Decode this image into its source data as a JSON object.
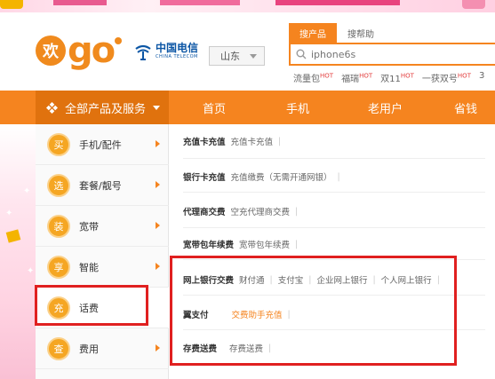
{
  "header": {
    "logo_huan": "欢",
    "logo_go": "go",
    "telecom_cn": "中国电信",
    "telecom_en": "CHINA TELECOM",
    "region": "山东"
  },
  "search": {
    "tabs": [
      "搜产品",
      "搜帮助"
    ],
    "placeholder": "iphone6s",
    "hot_links": [
      {
        "label": "流量包",
        "badge": "HOT"
      },
      {
        "label": "福瑞",
        "badge": "HOT"
      },
      {
        "label": "双11",
        "badge": "HOT"
      },
      {
        "label": "一获双号",
        "badge": "HOT"
      },
      {
        "label": "3",
        "badge": ""
      }
    ]
  },
  "nav": {
    "all_products": "全部产品及服务",
    "items": [
      "首页",
      "手机",
      "老用户",
      "省钱"
    ]
  },
  "categories": [
    {
      "icon": "买",
      "label": "手机/配件"
    },
    {
      "icon": "选",
      "label": "套餐/靓号"
    },
    {
      "icon": "装",
      "label": "宽带"
    },
    {
      "icon": "享",
      "label": "智能"
    },
    {
      "icon": "充",
      "label": "话费"
    },
    {
      "icon": "查",
      "label": "费用"
    }
  ],
  "panel": {
    "rows": [
      {
        "title": "充值卡充值",
        "links": [
          "充值卡充值"
        ]
      },
      {
        "title": "银行卡充值",
        "links": [
          "充值缴费（无需开通网银）"
        ]
      },
      {
        "title": "代理商交费",
        "links": [
          "空充代理商交费"
        ]
      },
      {
        "title": "宽带包年续费",
        "links": [
          "宽带包年续费"
        ]
      },
      {
        "title": "网上银行交费",
        "links": [
          "财付通",
          "支付宝",
          "企业网上银行",
          "个人网上银行"
        ]
      },
      {
        "title": "翼支付",
        "links": [
          "交费助手充值"
        ]
      },
      {
        "title": "存费送费",
        "links": [
          "存费送费"
        ]
      }
    ]
  },
  "colors": {
    "brand_orange": "#f5841f",
    "annotation_red": "#e02020"
  }
}
